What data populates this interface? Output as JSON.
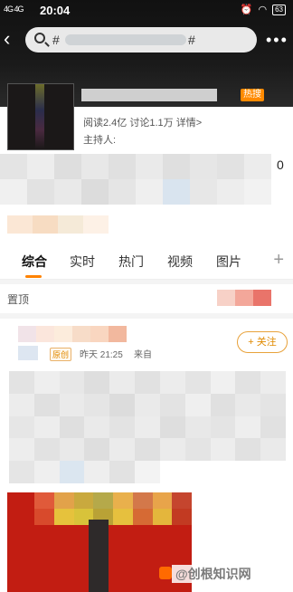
{
  "status_bar": {
    "network": "4G 4G",
    "time": "20:04",
    "battery": "63"
  },
  "search": {
    "hash_open": "#",
    "hash_close": "#"
  },
  "topic": {
    "hot_badge": "热搜",
    "stats": "阅读2.4亿  讨论1.1万  详情>",
    "host_label": "主持人:",
    "count_digit": "0"
  },
  "tabs": [
    {
      "label": "综合"
    },
    {
      "label": "实时"
    },
    {
      "label": "热门"
    },
    {
      "label": "视频"
    },
    {
      "label": "图片"
    }
  ],
  "tab_add": "+",
  "pinned": {
    "label": "置顶"
  },
  "post": {
    "original_badge": "原创",
    "time": "昨天 21:25",
    "source": "来自",
    "follow": "+ 关注"
  },
  "watermark": "@创根知识网",
  "colors": {
    "accent": "#ff8200",
    "hot_badge": "#ff8a00",
    "media_red": "#c21d12"
  },
  "icons": [
    "back-arrow-icon",
    "search-icon",
    "more-dots-icon",
    "plus-icon",
    "site-logo-icon"
  ]
}
